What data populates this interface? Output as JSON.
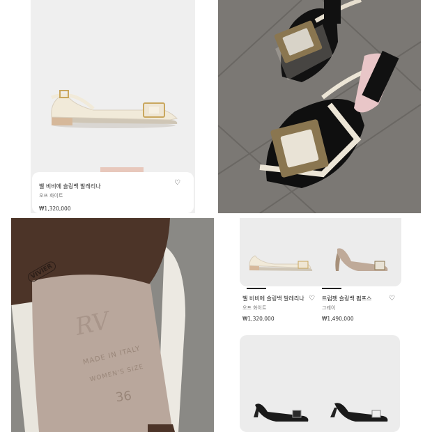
{
  "top_left_card": {
    "name": "벨 비비에 슬링백 발레리나",
    "color": "오프 화이트",
    "price": "₩1,320,000",
    "wishlist_icon": "heart-outline-icon"
  },
  "bottom_right_grid": {
    "products": [
      {
        "name": "벨 비비에 슬링백 발레리나",
        "color": "오프 화이트",
        "price": "₩1,320,000",
        "wishlist_icon": "heart-outline-icon"
      },
      {
        "name": "트럼펫 슬링백 펌프스",
        "color": "그레이",
        "price": "₩1,490,000",
        "wishlist_icon": "heart-outline-icon"
      }
    ]
  },
  "insole": {
    "brand_mark": "RV",
    "stamp_line1": "MADE IN ITALY",
    "stamp_line2": "WOMEN'S SIZE",
    "size": "36",
    "outsole_logo": "VIVIER"
  },
  "colors": {
    "panel_bg": "#efefef",
    "card_bg": "#ffffff",
    "tile_floor": "#7b7874",
    "insole_leather": "#b9a79c",
    "outsole_brown": "#4c3428"
  }
}
